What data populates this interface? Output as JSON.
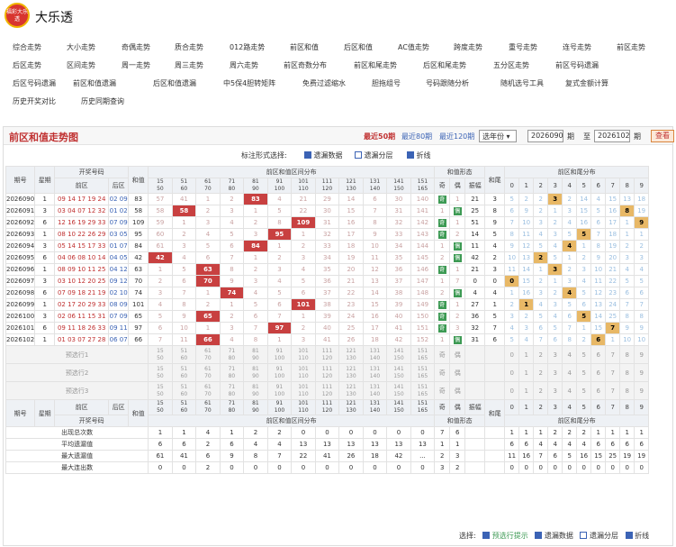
{
  "app": {
    "logo_text": "福彩大乐透",
    "title": "大乐透"
  },
  "nav": [
    [
      "综合走势",
      "大小走势",
      "奇偶走势",
      "质合走势",
      "012路走势",
      "前区和值",
      "后区和值",
      "AC值走势",
      "跨度走势",
      "重号走势",
      "连号走势",
      "前区走势"
    ],
    [
      "后区走势",
      "区间走势",
      "周一走势",
      "周三走势",
      "周六走势",
      "前区奇数分布",
      "前区和尾走势",
      "后区和尾走势",
      "五分区走势",
      "前区号码遗漏"
    ],
    [
      "后区号码遗漏",
      "前区和值遗漏",
      "后区和值遗漏",
      "中5保4胆转矩阵",
      "免费过滤缩水",
      "胆拖组号",
      "号码跟随分析",
      "随机选号工具",
      "复式金额计算"
    ],
    [
      "历史开奖对比",
      "历史同期查询"
    ]
  ],
  "panel": {
    "title": "前区和值走势图",
    "periods": [
      "最近50期",
      "最近80期",
      "最近120期"
    ],
    "select": "选年份",
    "from": "2026090",
    "to": "2026102",
    "from_lbl": "期",
    "to_prefix": "至",
    "query": "查看"
  },
  "opts": {
    "label": "标注形式选择:",
    "items": [
      "遗漏数据",
      "遗漏分层",
      "折线"
    ]
  },
  "headers": {
    "period": "期号",
    "week": "星期",
    "draw": "开奖号码",
    "front": "前区",
    "back": "后区",
    "sum": "和值",
    "dist": "前区和值区间分布",
    "shape": "和值形态",
    "odd": "奇",
    "even": "偶",
    "amp": "振幅",
    "tail": "和尾",
    "taildist": "前区和尾分布",
    "select1": "预选行1",
    "select2": "预选行2",
    "select3": "预选行3"
  },
  "ranges": [
    [
      "15",
      "50"
    ],
    [
      "51",
      "60"
    ],
    [
      "61",
      "70"
    ],
    [
      "71",
      "80"
    ],
    [
      "81",
      "90"
    ],
    [
      "91",
      "100"
    ],
    [
      "101",
      "110"
    ],
    [
      "111",
      "120"
    ],
    [
      "121",
      "130"
    ],
    [
      "131",
      "140"
    ],
    [
      "141",
      "150"
    ],
    [
      "151",
      "165"
    ]
  ],
  "tails": [
    "0",
    "1",
    "2",
    "3",
    "4",
    "5",
    "6",
    "7",
    "8",
    "9"
  ],
  "rows": [
    {
      "p": "2026090",
      "w": "1",
      "f": "09 14 17 19 24",
      "b": "02 09",
      "s": "83",
      "dist": [
        "57",
        "41",
        "1",
        "2",
        "83",
        "4",
        "21",
        "29",
        "14",
        "6",
        "30",
        "140"
      ],
      "hit": 4,
      "odd": "奇",
      "even": "1",
      "amp": "21",
      "tail": "3",
      "td": [
        "5",
        "2",
        "2",
        "3",
        "2",
        "14",
        "4",
        "15",
        "13",
        "18"
      ],
      "th": 3
    },
    {
      "p": "2026091",
      "w": "3",
      "f": "03 04 07 12 32",
      "b": "01 02",
      "s": "58",
      "dist": [
        "58",
        "58",
        "2",
        "3",
        "1",
        "5",
        "22",
        "30",
        "15",
        "7",
        "31",
        "141"
      ],
      "hit": 1,
      "odd": "1",
      "even": "偶",
      "amp": "25",
      "tail": "8",
      "td": [
        "6",
        "9",
        "2",
        "1",
        "3",
        "15",
        "5",
        "16",
        "8",
        "19"
      ],
      "th": 8
    },
    {
      "p": "2026092",
      "w": "6",
      "f": "12 16 19 29 33",
      "b": "07 09",
      "s": "109",
      "dist": [
        "59",
        "1",
        "3",
        "4",
        "2",
        "8",
        "109",
        "31",
        "16",
        "8",
        "32",
        "142"
      ],
      "hit": 6,
      "odd": "奇",
      "even": "1",
      "amp": "51",
      "tail": "9",
      "td": [
        "7",
        "10",
        "3",
        "2",
        "4",
        "16",
        "6",
        "17",
        "1",
        "9"
      ],
      "th": 9
    },
    {
      "p": "2026093",
      "w": "1",
      "f": "08 10 22 26 29",
      "b": "03 05",
      "s": "95",
      "dist": [
        "60",
        "2",
        "4",
        "5",
        "3",
        "95",
        "1",
        "32",
        "17",
        "9",
        "33",
        "143"
      ],
      "hit": 5,
      "odd": "奇",
      "even": "2",
      "amp": "14",
      "tail": "5",
      "td": [
        "8",
        "11",
        "4",
        "3",
        "5",
        "5",
        "7",
        "18",
        "1",
        "1"
      ],
      "th": 5
    },
    {
      "p": "2026094",
      "w": "3",
      "f": "05 14 15 17 33",
      "b": "01 07",
      "s": "84",
      "dist": [
        "61",
        "3",
        "5",
        "6",
        "84",
        "1",
        "2",
        "33",
        "18",
        "10",
        "34",
        "144"
      ],
      "hit": 4,
      "odd": "1",
      "even": "偶",
      "amp": "11",
      "tail": "4",
      "td": [
        "9",
        "12",
        "5",
        "4",
        "4",
        "1",
        "8",
        "19",
        "2",
        "2"
      ],
      "th": 4
    },
    {
      "p": "2026095",
      "w": "6",
      "f": "04 06 08 10 14",
      "b": "04 05",
      "s": "42",
      "dist": [
        "42",
        "4",
        "6",
        "7",
        "1",
        "2",
        "3",
        "34",
        "19",
        "11",
        "35",
        "145"
      ],
      "hit": 0,
      "odd": "2",
      "even": "偶",
      "amp": "42",
      "tail": "2",
      "td": [
        "10",
        "13",
        "2",
        "5",
        "1",
        "2",
        "9",
        "20",
        "3",
        "3"
      ],
      "th": 2
    },
    {
      "p": "2026096",
      "w": "1",
      "f": "08 09 10 11 25",
      "b": "04 12",
      "s": "63",
      "dist": [
        "1",
        "5",
        "63",
        "8",
        "2",
        "3",
        "4",
        "35",
        "20",
        "12",
        "36",
        "146"
      ],
      "hit": 2,
      "odd": "奇",
      "even": "1",
      "amp": "21",
      "tail": "3",
      "td": [
        "11",
        "14",
        "1",
        "3",
        "2",
        "3",
        "10",
        "21",
        "4",
        "4"
      ],
      "th": 3
    },
    {
      "p": "2026097",
      "w": "3",
      "f": "03 10 12 20 25",
      "b": "09 12",
      "s": "70",
      "dist": [
        "2",
        "6",
        "70",
        "9",
        "3",
        "4",
        "5",
        "36",
        "21",
        "13",
        "37",
        "147"
      ],
      "hit": 2,
      "odd": "1",
      "even": "7",
      "amp": "0",
      "tail": "0",
      "td": [
        "0",
        "15",
        "2",
        "1",
        "3",
        "4",
        "11",
        "22",
        "5",
        "5"
      ],
      "th": 0
    },
    {
      "p": "2026098",
      "w": "6",
      "f": "07 09 18 21 19",
      "b": "02 10",
      "s": "74",
      "dist": [
        "3",
        "7",
        "1",
        "74",
        "4",
        "5",
        "6",
        "37",
        "22",
        "14",
        "38",
        "148"
      ],
      "hit": 3,
      "odd": "2",
      "even": "偶",
      "amp": "4",
      "tail": "4",
      "td": [
        "1",
        "16",
        "3",
        "2",
        "4",
        "5",
        "12",
        "23",
        "6",
        "6"
      ],
      "th": 4
    },
    {
      "p": "2026099",
      "w": "1",
      "f": "02 17 20 29 33",
      "b": "08 09",
      "s": "101",
      "dist": [
        "4",
        "8",
        "2",
        "1",
        "5",
        "6",
        "101",
        "38",
        "23",
        "15",
        "39",
        "149"
      ],
      "hit": 6,
      "odd": "奇",
      "even": "1",
      "amp": "27",
      "tail": "1",
      "td": [
        "2",
        "1",
        "4",
        "3",
        "5",
        "6",
        "13",
        "24",
        "7",
        "7"
      ],
      "th": 1
    },
    {
      "p": "2026100",
      "w": "3",
      "f": "02 06 11 15 31",
      "b": "07 09",
      "s": "65",
      "dist": [
        "5",
        "9",
        "65",
        "2",
        "6",
        "7",
        "1",
        "39",
        "24",
        "16",
        "40",
        "150"
      ],
      "hit": 2,
      "odd": "奇",
      "even": "2",
      "amp": "36",
      "tail": "5",
      "td": [
        "3",
        "2",
        "5",
        "4",
        "6",
        "5",
        "14",
        "25",
        "8",
        "8"
      ],
      "th": 5
    },
    {
      "p": "2026101",
      "w": "6",
      "f": "09 11 18 26 33",
      "b": "09 11",
      "s": "97",
      "dist": [
        "6",
        "10",
        "1",
        "3",
        "7",
        "97",
        "2",
        "40",
        "25",
        "17",
        "41",
        "151"
      ],
      "hit": 5,
      "odd": "奇",
      "even": "3",
      "amp": "32",
      "tail": "7",
      "td": [
        "4",
        "3",
        "6",
        "5",
        "7",
        "1",
        "15",
        "7",
        "9",
        "9"
      ],
      "th": 7
    },
    {
      "p": "2026102",
      "w": "1",
      "f": "01 03 07 27 28",
      "b": "06 07",
      "s": "66",
      "dist": [
        "7",
        "11",
        "66",
        "4",
        "8",
        "1",
        "3",
        "41",
        "26",
        "18",
        "42",
        "152"
      ],
      "hit": 2,
      "odd": "1",
      "even": "偶",
      "amp": "31",
      "tail": "6",
      "td": [
        "5",
        "4",
        "7",
        "6",
        "8",
        "2",
        "6",
        "1",
        "10",
        "10"
      ],
      "th": 6
    }
  ],
  "stats": [
    {
      "name": "出现总次数",
      "dist": [
        "1",
        "1",
        "4",
        "1",
        "2",
        "2",
        "0",
        "0",
        "0",
        "0",
        "0",
        "0"
      ],
      "shape": [
        "7",
        "6"
      ],
      "td": [
        "1",
        "1",
        "1",
        "2",
        "2",
        "2",
        "1",
        "1",
        "1",
        "1"
      ]
    },
    {
      "name": "平均遗漏值",
      "dist": [
        "6",
        "6",
        "2",
        "6",
        "4",
        "4",
        "13",
        "13",
        "13",
        "13",
        "13",
        "13"
      ],
      "shape": [
        "1",
        "1"
      ],
      "td": [
        "6",
        "6",
        "4",
        "4",
        "4",
        "4",
        "6",
        "6",
        "6",
        "6"
      ]
    },
    {
      "name": "最大遗漏值",
      "dist": [
        "61",
        "41",
        "6",
        "9",
        "8",
        "7",
        "22",
        "41",
        "26",
        "18",
        "42",
        "..."
      ],
      "shape": [
        "2",
        "3"
      ],
      "td": [
        "11",
        "16",
        "7",
        "6",
        "5",
        "16",
        "15",
        "25",
        "19",
        "19"
      ]
    },
    {
      "name": "最大连出数",
      "dist": [
        "0",
        "0",
        "2",
        "0",
        "0",
        "0",
        "0",
        "0",
        "0",
        "0",
        "0",
        "0"
      ],
      "shape": [
        "3",
        "2"
      ],
      "td": [
        "0",
        "0",
        "0",
        "0",
        "0",
        "0",
        "0",
        "0",
        "0",
        "0"
      ]
    }
  ],
  "footer": {
    "label": "选择:",
    "items": [
      "预选行提示",
      "遗漏数据",
      "遗漏分层",
      "折线"
    ]
  }
}
